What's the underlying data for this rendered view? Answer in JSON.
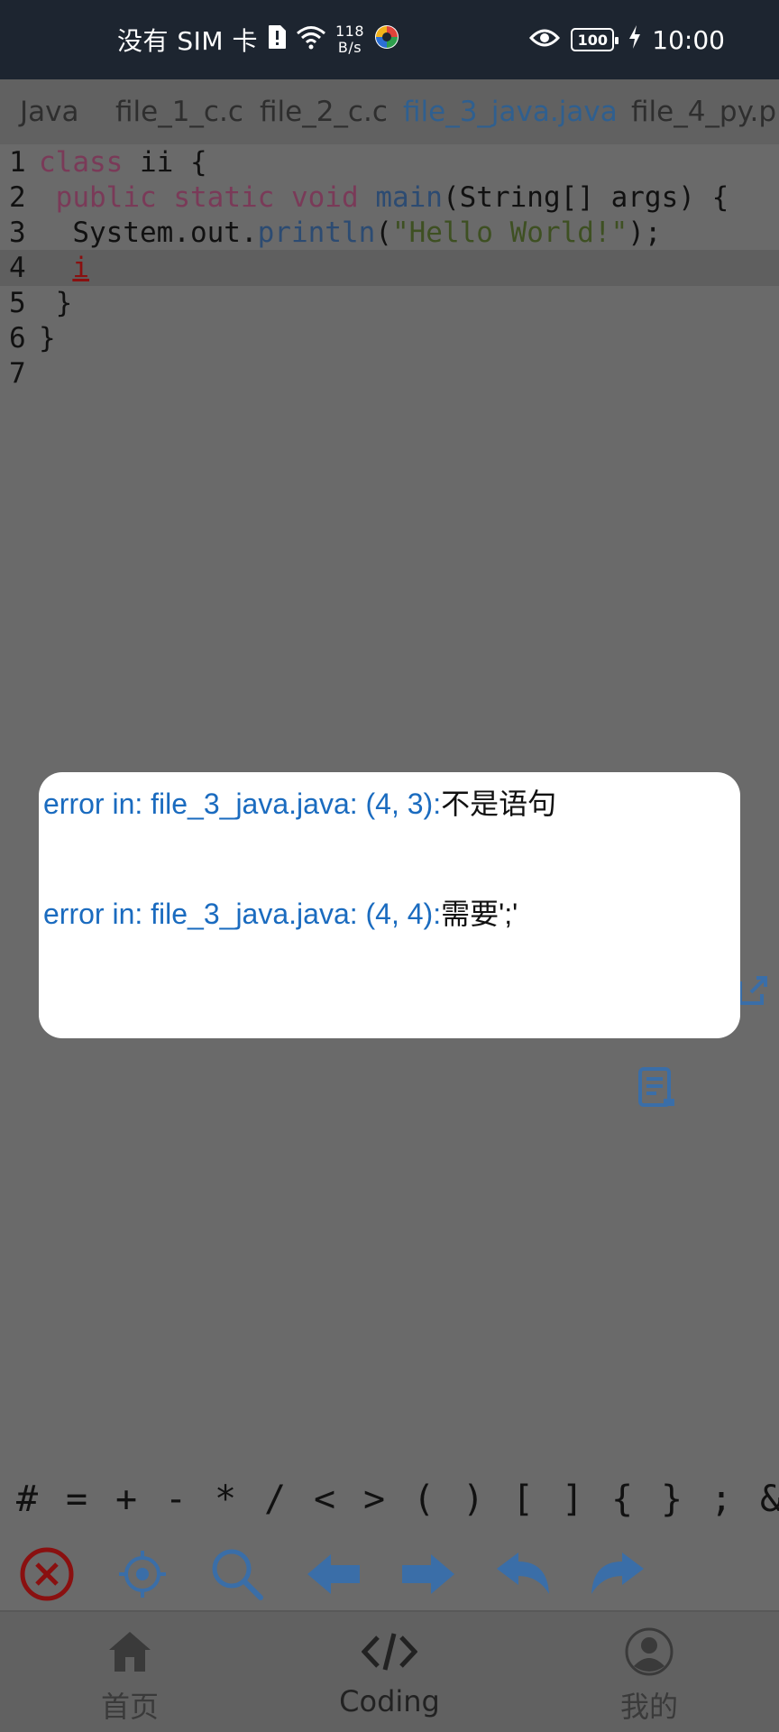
{
  "status_bar": {
    "carrier": "没有 SIM 卡",
    "net_speed_value": "118",
    "net_speed_unit": "B/s",
    "battery_level": "100",
    "time": "10:00"
  },
  "tabs": [
    {
      "label": "Java",
      "active": false
    },
    {
      "label": "file_1_c.c",
      "active": false
    },
    {
      "label": "file_2_c.c",
      "active": false
    },
    {
      "label": "file_3_java.java",
      "active": true
    },
    {
      "label": "file_4_py.p",
      "active": false
    }
  ],
  "editor": {
    "lines": [
      {
        "num": "1",
        "segments": [
          {
            "t": "class",
            "c": "kw"
          },
          {
            "t": " ii {",
            "c": ""
          }
        ]
      },
      {
        "num": "2",
        "segments": [
          {
            "t": " ",
            "c": ""
          },
          {
            "t": "public",
            "c": "kw"
          },
          {
            "t": " ",
            "c": ""
          },
          {
            "t": "static",
            "c": "kw"
          },
          {
            "t": " ",
            "c": ""
          },
          {
            "t": "void",
            "c": "kw"
          },
          {
            "t": " ",
            "c": ""
          },
          {
            "t": "main",
            "c": "fn"
          },
          {
            "t": "(String[] args) {",
            "c": ""
          }
        ]
      },
      {
        "num": "3",
        "segments": [
          {
            "t": "  System.out.",
            "c": ""
          },
          {
            "t": "println",
            "c": "fn"
          },
          {
            "t": "(",
            "c": ""
          },
          {
            "t": "\"Hello World!\"",
            "c": "str"
          },
          {
            "t": ");",
            "c": ""
          }
        ]
      },
      {
        "num": "4",
        "segments": [
          {
            "t": "  ",
            "c": ""
          },
          {
            "t": "i",
            "c": "err"
          }
        ],
        "current": true
      },
      {
        "num": "5",
        "segments": [
          {
            "t": " }",
            "c": ""
          }
        ]
      },
      {
        "num": "6",
        "segments": [
          {
            "t": "}",
            "c": ""
          }
        ]
      },
      {
        "num": "7",
        "segments": []
      }
    ]
  },
  "dialog": {
    "errors": [
      {
        "prefix": "error in: file_3_java.java: (4, 3):",
        "message": "不是语句"
      },
      {
        "prefix": "error in: file_3_java.java: (4, 4):",
        "message": "需要';'"
      }
    ]
  },
  "symbols": [
    "#",
    "=",
    "+",
    "-",
    "*",
    "/",
    "<",
    ">",
    "(",
    ")",
    "[",
    "]",
    "{",
    "}",
    ";",
    "&"
  ],
  "toolbar": {
    "icons": [
      "close-circle-icon",
      "locate-icon",
      "search-icon",
      "arrow-left-icon",
      "arrow-right-icon",
      "undo-icon",
      "redo-icon"
    ]
  },
  "bottom_nav": {
    "items": [
      {
        "label": "首页",
        "icon": "home-icon"
      },
      {
        "label": "Coding",
        "icon": "code-icon",
        "active": true
      },
      {
        "label": "我的",
        "icon": "profile-icon"
      }
    ]
  },
  "colors": {
    "accent": "#1a6bbf",
    "error": "#8a1010",
    "overlay_bg": "#6a6a6a"
  }
}
